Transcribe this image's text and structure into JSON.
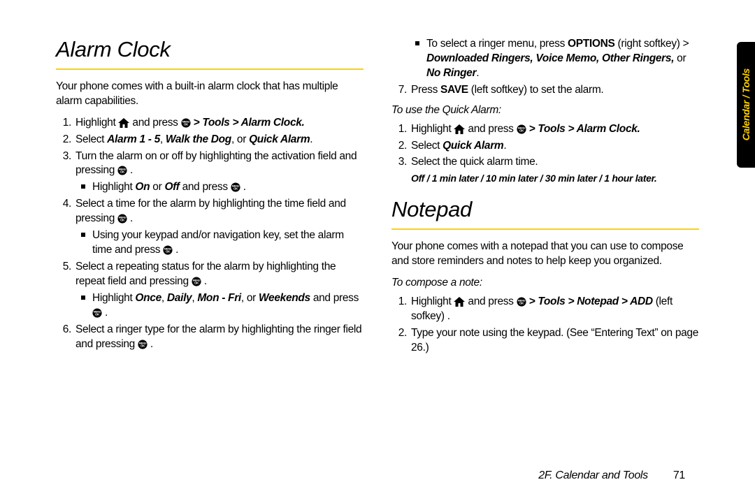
{
  "tab_label": "Calendar / Tools",
  "footer_section": "2F. Calendar and Tools",
  "page_number": "71",
  "left": {
    "title": "Alarm Clock",
    "intro": "Your phone comes with a built-in alarm clock that has multiple alarm capabilities.",
    "step1_pre": "Highlight ",
    "step1_mid": " and press ",
    "step1_nav": " > Tools > Alarm Clock.",
    "step2_pre": "Select ",
    "step2_b1": "Alarm 1 - 5",
    "step2_sep1": ", ",
    "step2_b2": "Walk the Dog",
    "step2_sep2": ", or ",
    "step2_b3": "Quick Alarm",
    "step2_end": ".",
    "step3a": "Turn the alarm on or off by highlighting the activation field and pressing ",
    "step3a_end": " .",
    "step3b_pre": "Highlight ",
    "step3b_on": "On",
    "step3b_or": " or ",
    "step3b_off": "Off",
    "step3b_mid": " and press ",
    "step3b_end": " .",
    "step4a": "Select a time for the alarm by highlighting the time field and pressing ",
    "step4a_end": " .",
    "step4b": "Using your keypad and/or navigation key, set the alarm time and press ",
    "step4b_end": " .",
    "step5a": "Select a repeating status for the alarm by highlighting the repeat field and pressing ",
    "step5a_end": " .",
    "step5b_pre": "Highlight ",
    "step5b_once": "Once",
    "step5b_c1": ", ",
    "step5b_daily": "Daily",
    "step5b_c2": ", ",
    "step5b_mf": "Mon - Fri",
    "step5b_c3": ", or ",
    "step5b_wk": "Weekends",
    "step5b_mid": " and press ",
    "step5b_end": " .",
    "step6": "Select a ringer type for the alarm by highlighting the ringer field and pressing ",
    "step6_end": " ."
  },
  "right": {
    "cont_bullet_pre": "To select a ringer menu, press ",
    "cont_options": "OPTIONS",
    "cont_bullet_mid": " (right softkey) > ",
    "cont_opts_list": "Downloaded Ringers, Voice Memo, Other Ringers,",
    "cont_or": " or ",
    "cont_nr": "No Ringer",
    "cont_end": ".",
    "step7_pre": "Press ",
    "step7_save": "SAVE",
    "step7_end": " (left softkey) to set the alarm.",
    "quick_head": "To use the Quick Alarm:",
    "q1_pre": "Highlight ",
    "q1_mid": " and press ",
    "q1_nav": " > Tools > Alarm Clock.",
    "q2_pre": "Select ",
    "q2_b": "Quick Alarm",
    "q2_end": ".",
    "q3": "Select the quick alarm time.",
    "q3_sub": "Off / 1 min later / 10 min later / 30 min later / 1 hour later.",
    "notepad_title": "Notepad",
    "notepad_intro": "Your phone comes with a notepad that you can use to compose and store reminders and notes to help keep you organized.",
    "compose_head": "To compose a note:",
    "n1_pre": "Highlight ",
    "n1_mid": " and press ",
    "n1_nav": " > Tools > Notepad > ADD",
    "n1_end": " (left sofkey) .",
    "n2": "Type your note using the keypad. (See “Entering Text” on page 26.)"
  }
}
